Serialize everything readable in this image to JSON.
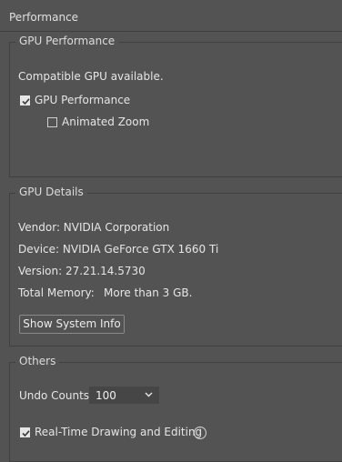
{
  "header": {
    "title": "Performance"
  },
  "gpu_performance": {
    "legend": "GPU Performance",
    "status": "Compatible GPU available.",
    "gpu_checkbox_label": "GPU Performance",
    "gpu_checked": true,
    "zoom_checkbox_label": "Animated Zoom",
    "zoom_checked": false
  },
  "gpu_details": {
    "legend": "GPU Details",
    "vendor": "Vendor: NVIDIA Corporation",
    "device": "Device: NVIDIA GeForce GTX 1660 Ti",
    "version": "Version: 27.21.14.5730",
    "memory_label": "Total Memory:",
    "memory_value": "More than 3 GB.",
    "button_label": "Show System Info"
  },
  "others": {
    "legend": "Others",
    "undo_label": "Undo Counts:",
    "undo_value": "100",
    "realtime_label": "Real-Time Drawing and Editing",
    "realtime_checked": true,
    "info_glyph": "i"
  }
}
